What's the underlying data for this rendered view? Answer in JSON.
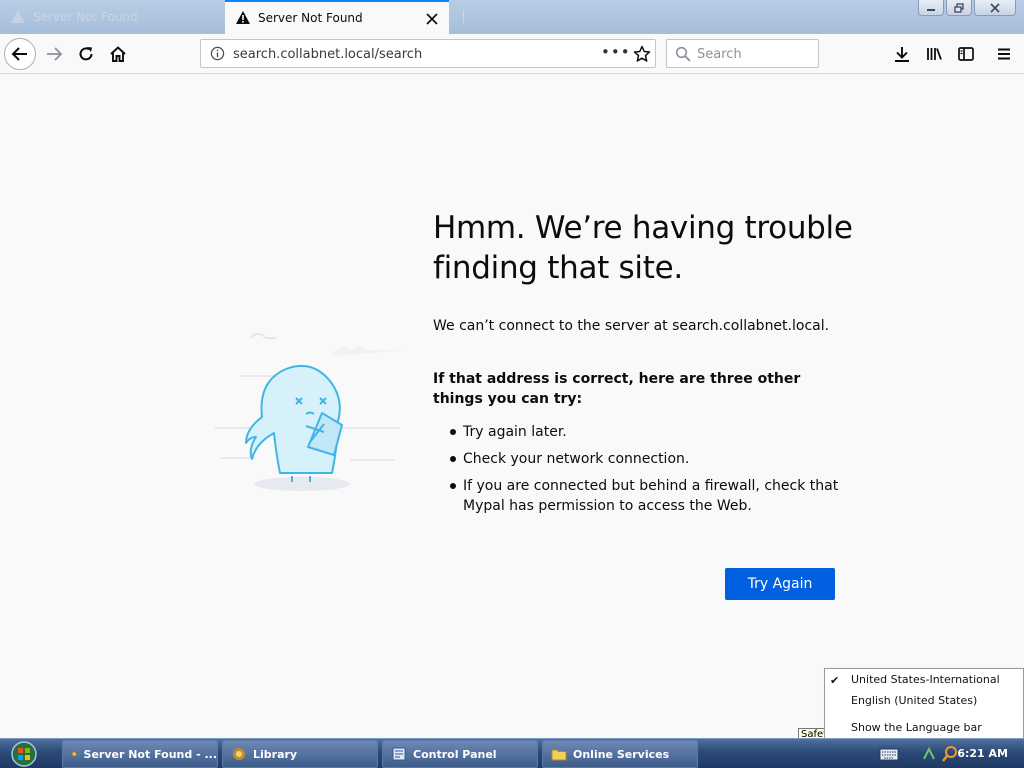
{
  "browser": {
    "tabs": [
      {
        "title": "Server Not Found",
        "active": false
      },
      {
        "title": "Server Not Found",
        "active": true
      }
    ],
    "url": "search.collabnet.local/search",
    "search_placeholder": "Search",
    "accent_color": "#0a84ff"
  },
  "error_page": {
    "title": "Hmm. We’re having trouble finding that site.",
    "description": "We can’t connect to the server at search.collabnet.local.",
    "subtitle": "If that address is correct, here are three other things you can try:",
    "suggestions": [
      "Try again later.",
      "Check your network connection.",
      "If you are connected but behind a firewall, check that Mypal has permission to access the Web."
    ],
    "try_again_label": "Try Again",
    "button_color": "#0060df"
  },
  "language_menu": {
    "items": [
      {
        "label": "United States-International",
        "checked": true
      },
      {
        "label": "English (United States)",
        "checked": false
      },
      {
        "label": "Show the Language bar",
        "checked": false
      }
    ],
    "tooltip": "Safety"
  },
  "taskbar": {
    "items": [
      {
        "label": "Server Not Found - ...",
        "icon": "mypal-icon"
      },
      {
        "label": "Library",
        "icon": "mypal-icon"
      },
      {
        "label": "Control Panel",
        "icon": "control-panel-icon"
      },
      {
        "label": "Online Services",
        "icon": "folder-icon"
      }
    ],
    "clock": "6:21 AM"
  }
}
